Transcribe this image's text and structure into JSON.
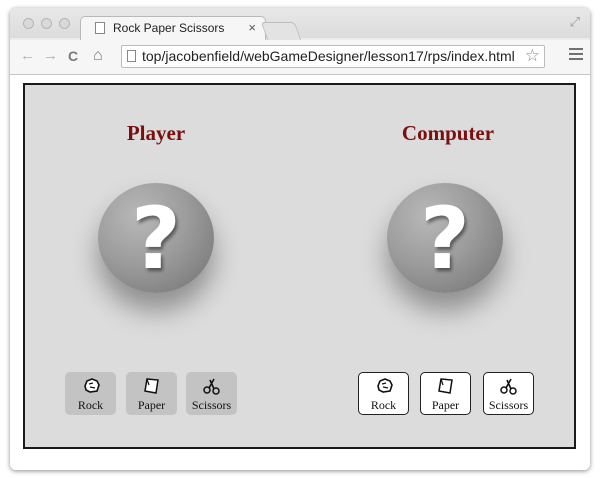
{
  "browser": {
    "tab_title": "Rock Paper Scissors",
    "tab_close": "×",
    "url": "top/jacobenfield/webGameDesigner/lesson17/rps/index.html",
    "star": "☆",
    "fullscreen": "⤢",
    "back": "←",
    "forward": "→",
    "reload": "C",
    "home": "⌂"
  },
  "game": {
    "player_title": "Player",
    "computer_title": "Computer",
    "mystery_mark": "?",
    "player_choices": [
      {
        "label": "Rock",
        "icon": "rock-icon"
      },
      {
        "label": "Paper",
        "icon": "paper-icon"
      },
      {
        "label": "Scissors",
        "icon": "scissors-icon"
      }
    ],
    "computer_choices": [
      {
        "label": "Rock",
        "icon": "rock-icon"
      },
      {
        "label": "Paper",
        "icon": "paper-icon"
      },
      {
        "label": "Scissors",
        "icon": "scissors-icon"
      }
    ]
  },
  "colors": {
    "title": "#7a0f0f",
    "game_bg": "#dcdcdc",
    "player_button_bg": "#c3c3c3",
    "computer_button_bg": "#ffffff"
  }
}
